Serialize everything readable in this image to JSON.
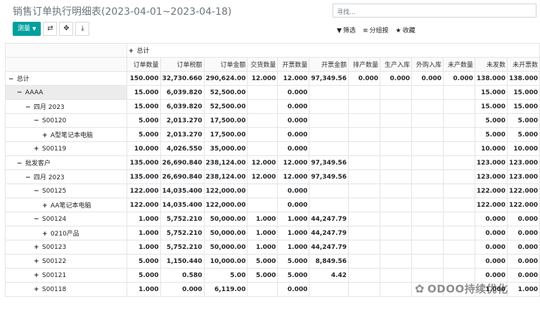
{
  "page": {
    "title": "销售订单执行明细表(2023-04-01~2023-04-18)",
    "search_placeholder": "寻找..."
  },
  "toolbar": {
    "measure_label": "测量",
    "flip_icon": "swap-axis-icon",
    "expand_icon": "expand-all-icon",
    "download_icon": "download-icon"
  },
  "filters": {
    "filter_label": "筛选",
    "group_label": "分组按",
    "favorite_label": "收藏"
  },
  "pivot": {
    "col_group_label": "总计",
    "columns": [
      "订单数量",
      "订单税额",
      "订单金额",
      "交货数量",
      "开票数量",
      "开票金额",
      "排产数量",
      "生产入库",
      "外购入库",
      "未产数量",
      "未发数",
      "未开票数"
    ],
    "rows": [
      {
        "label": "总计",
        "sign": "minus",
        "indent": 0,
        "highlight": false,
        "values": [
          "150.000",
          "32,730.660",
          "290,624.00",
          "12.000",
          "12.000",
          "97,349.56",
          "0.000",
          "0.000",
          "0.000",
          "0.000",
          "138.000",
          "138.000"
        ]
      },
      {
        "label": "AAAA",
        "sign": "minus",
        "indent": 1,
        "highlight": true,
        "values": [
          "15.000",
          "6,039.820",
          "52,500.00",
          "",
          "0.000",
          "",
          "",
          "",
          "",
          "",
          "15.000",
          "15.000"
        ]
      },
      {
        "label": "四月 2023",
        "sign": "minus",
        "indent": 2,
        "highlight": false,
        "values": [
          "15.000",
          "6,039.820",
          "52,500.00",
          "",
          "0.000",
          "",
          "",
          "",
          "",
          "",
          "15.000",
          "15.000"
        ]
      },
      {
        "label": "S00120",
        "sign": "minus",
        "indent": 3,
        "highlight": false,
        "values": [
          "5.000",
          "2,013.270",
          "17,500.00",
          "",
          "0.000",
          "",
          "",
          "",
          "",
          "",
          "5.000",
          "5.000"
        ]
      },
      {
        "label": "A型笔记本电脑",
        "sign": "plus",
        "indent": 4,
        "highlight": false,
        "values": [
          "5.000",
          "2,013.270",
          "17,500.00",
          "",
          "0.000",
          "",
          "",
          "",
          "",
          "",
          "5.000",
          "5.000"
        ]
      },
      {
        "label": "S00119",
        "sign": "plus",
        "indent": 3,
        "highlight": false,
        "values": [
          "10.000",
          "4,026.550",
          "35,000.00",
          "",
          "0.000",
          "",
          "",
          "",
          "",
          "",
          "10.000",
          "10.000"
        ]
      },
      {
        "label": "批发客户",
        "sign": "minus",
        "indent": 1,
        "highlight": false,
        "values": [
          "135.000",
          "26,690.840",
          "238,124.00",
          "12.000",
          "12.000",
          "97,349.56",
          "",
          "",
          "",
          "",
          "123.000",
          "123.000"
        ]
      },
      {
        "label": "四月 2023",
        "sign": "minus",
        "indent": 2,
        "highlight": false,
        "values": [
          "135.000",
          "26,690.840",
          "238,124.00",
          "12.000",
          "12.000",
          "97,349.56",
          "",
          "",
          "",
          "",
          "123.000",
          "123.000"
        ]
      },
      {
        "label": "S00125",
        "sign": "minus",
        "indent": 3,
        "highlight": false,
        "values": [
          "122.000",
          "14,035.400",
          "122,000.00",
          "",
          "0.000",
          "",
          "",
          "",
          "",
          "",
          "122.000",
          "122.000"
        ]
      },
      {
        "label": "AA笔记本电脑",
        "sign": "plus",
        "indent": 4,
        "highlight": false,
        "values": [
          "122.000",
          "14,035.400",
          "122,000.00",
          "",
          "0.000",
          "",
          "",
          "",
          "",
          "",
          "122.000",
          "122.000"
        ]
      },
      {
        "label": "S00124",
        "sign": "minus",
        "indent": 3,
        "highlight": false,
        "values": [
          "1.000",
          "5,752.210",
          "50,000.00",
          "1.000",
          "1.000",
          "44,247.79",
          "",
          "",
          "",
          "",
          "0.000",
          "0.000"
        ]
      },
      {
        "label": "0210产品",
        "sign": "plus",
        "indent": 4,
        "highlight": false,
        "values": [
          "1.000",
          "5,752.210",
          "50,000.00",
          "1.000",
          "1.000",
          "44,247.79",
          "",
          "",
          "",
          "",
          "0.000",
          "0.000"
        ]
      },
      {
        "label": "S00123",
        "sign": "plus",
        "indent": 3,
        "highlight": false,
        "values": [
          "1.000",
          "5,752.210",
          "50,000.00",
          "1.000",
          "1.000",
          "44,247.79",
          "",
          "",
          "",
          "",
          "0.000",
          "0.000"
        ]
      },
      {
        "label": "S00122",
        "sign": "plus",
        "indent": 3,
        "highlight": false,
        "values": [
          "5.000",
          "1,150.440",
          "10,000.00",
          "5.000",
          "5.000",
          "8,849.56",
          "",
          "",
          "",
          "",
          "0.000",
          "0.000"
        ]
      },
      {
        "label": "S00121",
        "sign": "plus",
        "indent": 3,
        "highlight": false,
        "values": [
          "5.000",
          "0.580",
          "5.00",
          "5.000",
          "5.000",
          "4.42",
          "",
          "",
          "",
          "",
          "0.000",
          "0.000"
        ]
      },
      {
        "label": "S00118",
        "sign": "plus",
        "indent": 3,
        "highlight": false,
        "values": [
          "1.000",
          "0.000",
          "6,119.00",
          "",
          "0.000",
          "",
          "",
          "",
          "",
          "",
          "1.000",
          "1.000"
        ]
      }
    ]
  },
  "watermark": {
    "text": "ODOO持续优化",
    "icon": "wechat-icon"
  }
}
